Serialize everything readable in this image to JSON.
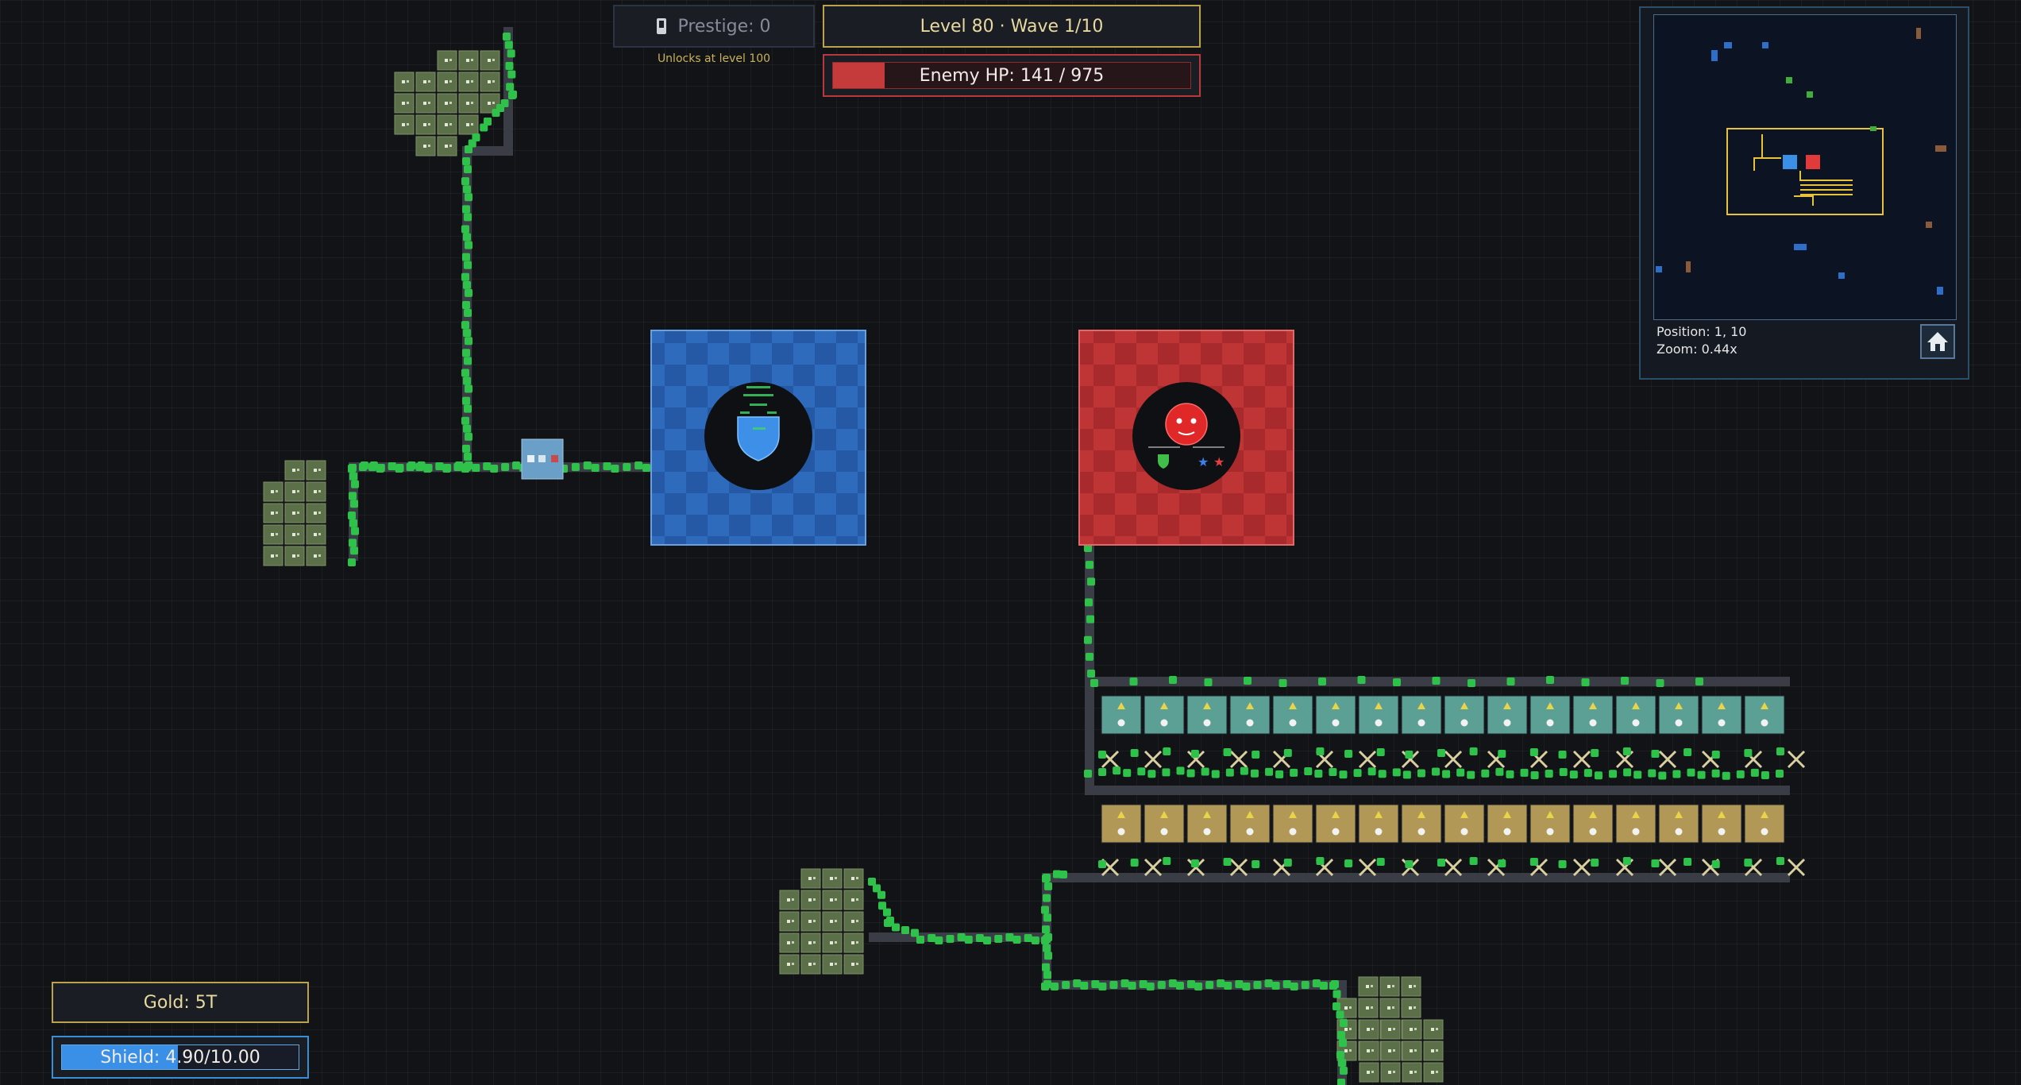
{
  "hud": {
    "prestige_label": "Prestige: 0",
    "prestige_icon": "phone-icon",
    "unlock_note": "Unlocks at level 100",
    "level_wave": "Level 80 · Wave 1/10",
    "enemy_hp": {
      "label": "Enemy HP: 141 / 975",
      "current": 141,
      "max": 975,
      "fill_color": "#c53a3a"
    },
    "gold_label": "Gold: 5T",
    "shield": {
      "label": "Shield: 4.90/10.00",
      "current": 4.9,
      "max": 10.0,
      "fill_color": "#3a8fe6"
    }
  },
  "minimap": {
    "position_label": "Position: 1, 10",
    "zoom_label": "Zoom: 0.44x",
    "home_icon": "home-icon"
  },
  "map": {
    "player_base_color": "#2f6bbd",
    "enemy_base_color": "#bf3434",
    "unit_color": "#2fc24a",
    "road_color": "#3a3d45",
    "farm_color": "#5b6f48",
    "tower_row_teal_color": "#5c9f95",
    "tower_row_gold_color": "#b29856",
    "icons": [
      "shield-icon",
      "enemy-face-icon",
      "star-icon",
      "crossed-swords-icon"
    ]
  }
}
